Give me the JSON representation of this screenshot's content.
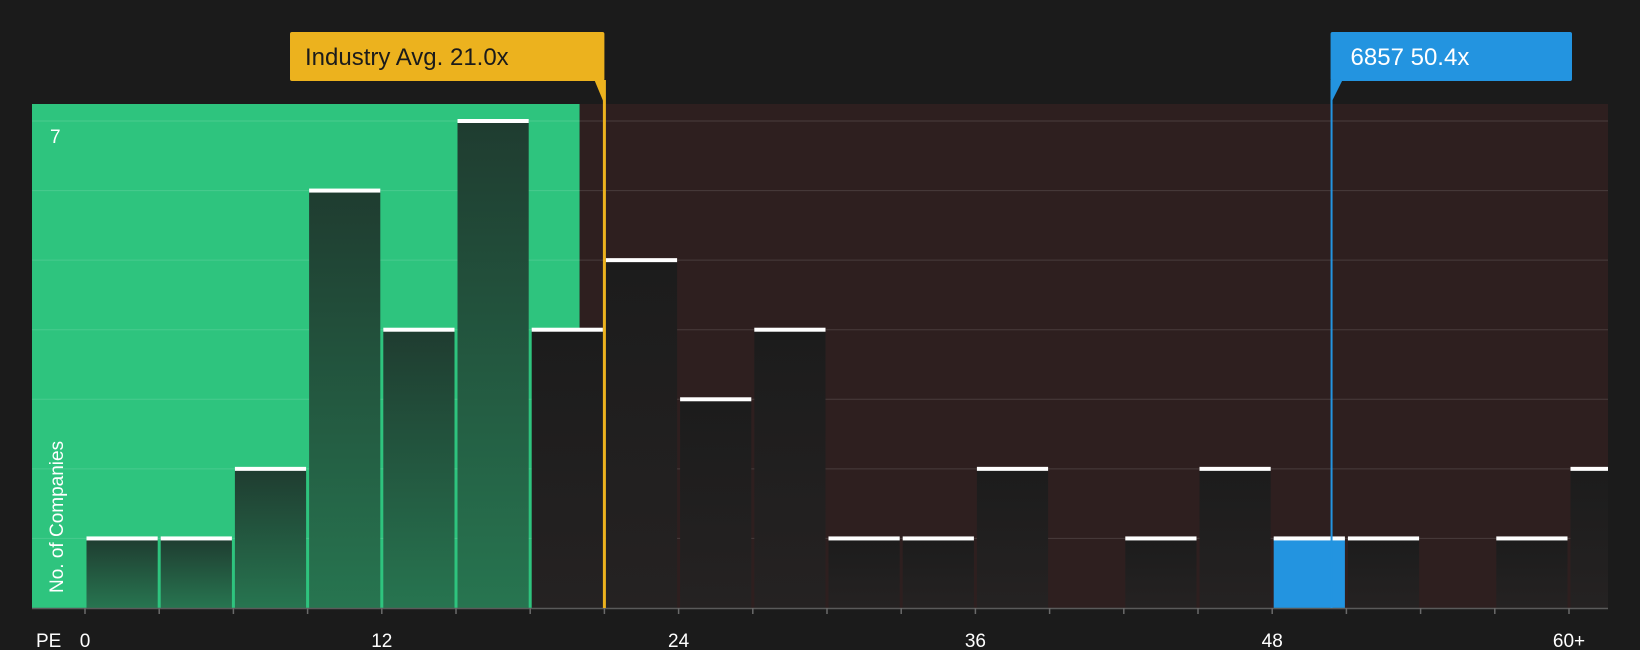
{
  "chart_data": {
    "type": "bar",
    "x_axis_label": "PE",
    "y_axis_label": "No. of Companies",
    "y_max_label": "7",
    "ylim": [
      0,
      7
    ],
    "y_gridlines": [
      1,
      2,
      3,
      4,
      5,
      6,
      7
    ],
    "x_ticks": [
      {
        "value": 0,
        "label": "0"
      },
      {
        "value": 12,
        "label": "12"
      },
      {
        "value": 24,
        "label": "24"
      },
      {
        "value": 36,
        "label": "36"
      },
      {
        "value": 48,
        "label": "48"
      },
      {
        "value": 60,
        "label": "60+"
      }
    ],
    "bin_width": 3,
    "bins": [
      {
        "start": 0,
        "count": 1
      },
      {
        "start": 3,
        "count": 1
      },
      {
        "start": 6,
        "count": 2
      },
      {
        "start": 9,
        "count": 6
      },
      {
        "start": 12,
        "count": 4
      },
      {
        "start": 15,
        "count": 7
      },
      {
        "start": 18,
        "count": 4
      },
      {
        "start": 21,
        "count": 5
      },
      {
        "start": 24,
        "count": 3
      },
      {
        "start": 27,
        "count": 4
      },
      {
        "start": 30,
        "count": 1
      },
      {
        "start": 33,
        "count": 1
      },
      {
        "start": 36,
        "count": 2
      },
      {
        "start": 39,
        "count": 0
      },
      {
        "start": 42,
        "count": 1
      },
      {
        "start": 45,
        "count": 2
      },
      {
        "start": 48,
        "count": 1,
        "highlight": true
      },
      {
        "start": 51,
        "count": 1
      },
      {
        "start": 54,
        "count": 0
      },
      {
        "start": 57,
        "count": 1
      },
      {
        "start": 60,
        "count": 2
      }
    ],
    "fair_zone_end": 20,
    "industry_avg": {
      "value": 21.0,
      "label": "Industry Avg. 21.0x"
    },
    "company": {
      "value": 50.4,
      "label": "6857 50.4x"
    },
    "colors": {
      "background": "#1b1b1b",
      "fair_zone": "#2ec47e",
      "over_zone": "#2e1f1f",
      "industry_avg": "#ecb21e",
      "company": "#2394e0"
    }
  }
}
